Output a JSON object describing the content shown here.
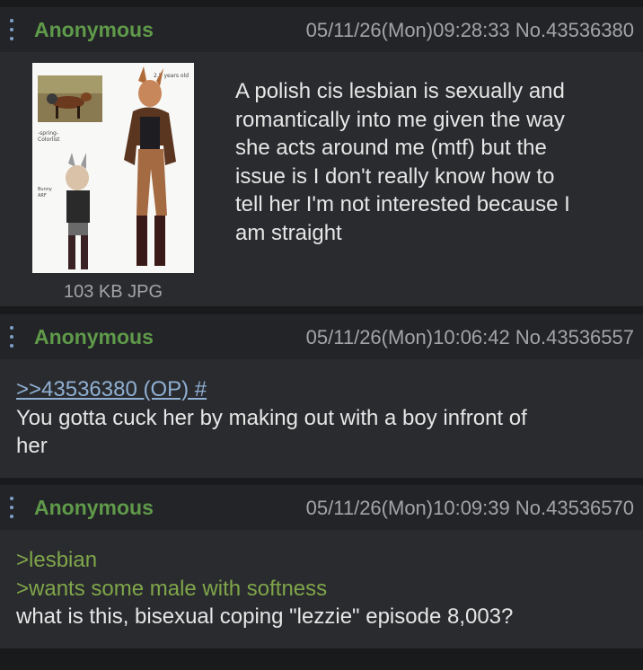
{
  "posts": [
    {
      "name": "Anonymous",
      "datetime": "05/11/26(Mon)09:28:33",
      "number": "No.43536380",
      "file_info": "103 KB JPG",
      "comment_lines": [
        "A polish cis lesbian is sexually and",
        "romantically into me given the way",
        "she acts around me (mtf) but the",
        "issue is I don't really know how to",
        "tell her I'm not interested because I",
        "am straight"
      ],
      "thumb_texts": [
        "2.5 years old",
        "-spring-",
        "Colorlist",
        "Bunny",
        "ARF"
      ]
    },
    {
      "name": "Anonymous",
      "datetime": "05/11/26(Mon)10:06:42",
      "number": "No.43536557",
      "quotelink": ">>43536380 (OP) #",
      "comment_lines": [
        "You gotta cuck her by making out with a boy infront of",
        "her"
      ]
    },
    {
      "name": "Anonymous",
      "datetime": "05/11/26(Mon)10:09:39",
      "number": "No.43536570",
      "greentext_lines": [
        ">lesbian",
        ">wants some male with softness"
      ],
      "comment_lines": [
        "what is this, bisexual coping \"lezzie\" episode 8,003?"
      ]
    }
  ],
  "colors": {
    "name": "#5f9a4a",
    "quotelink": "#8fb0d4",
    "greentext": "#7fa64a",
    "post_bg": "#2a2b2e",
    "header_bg": "#232427",
    "page_bg": "#191a1c"
  },
  "icons": {
    "post_menu": "vertical-ellipsis-icon"
  }
}
